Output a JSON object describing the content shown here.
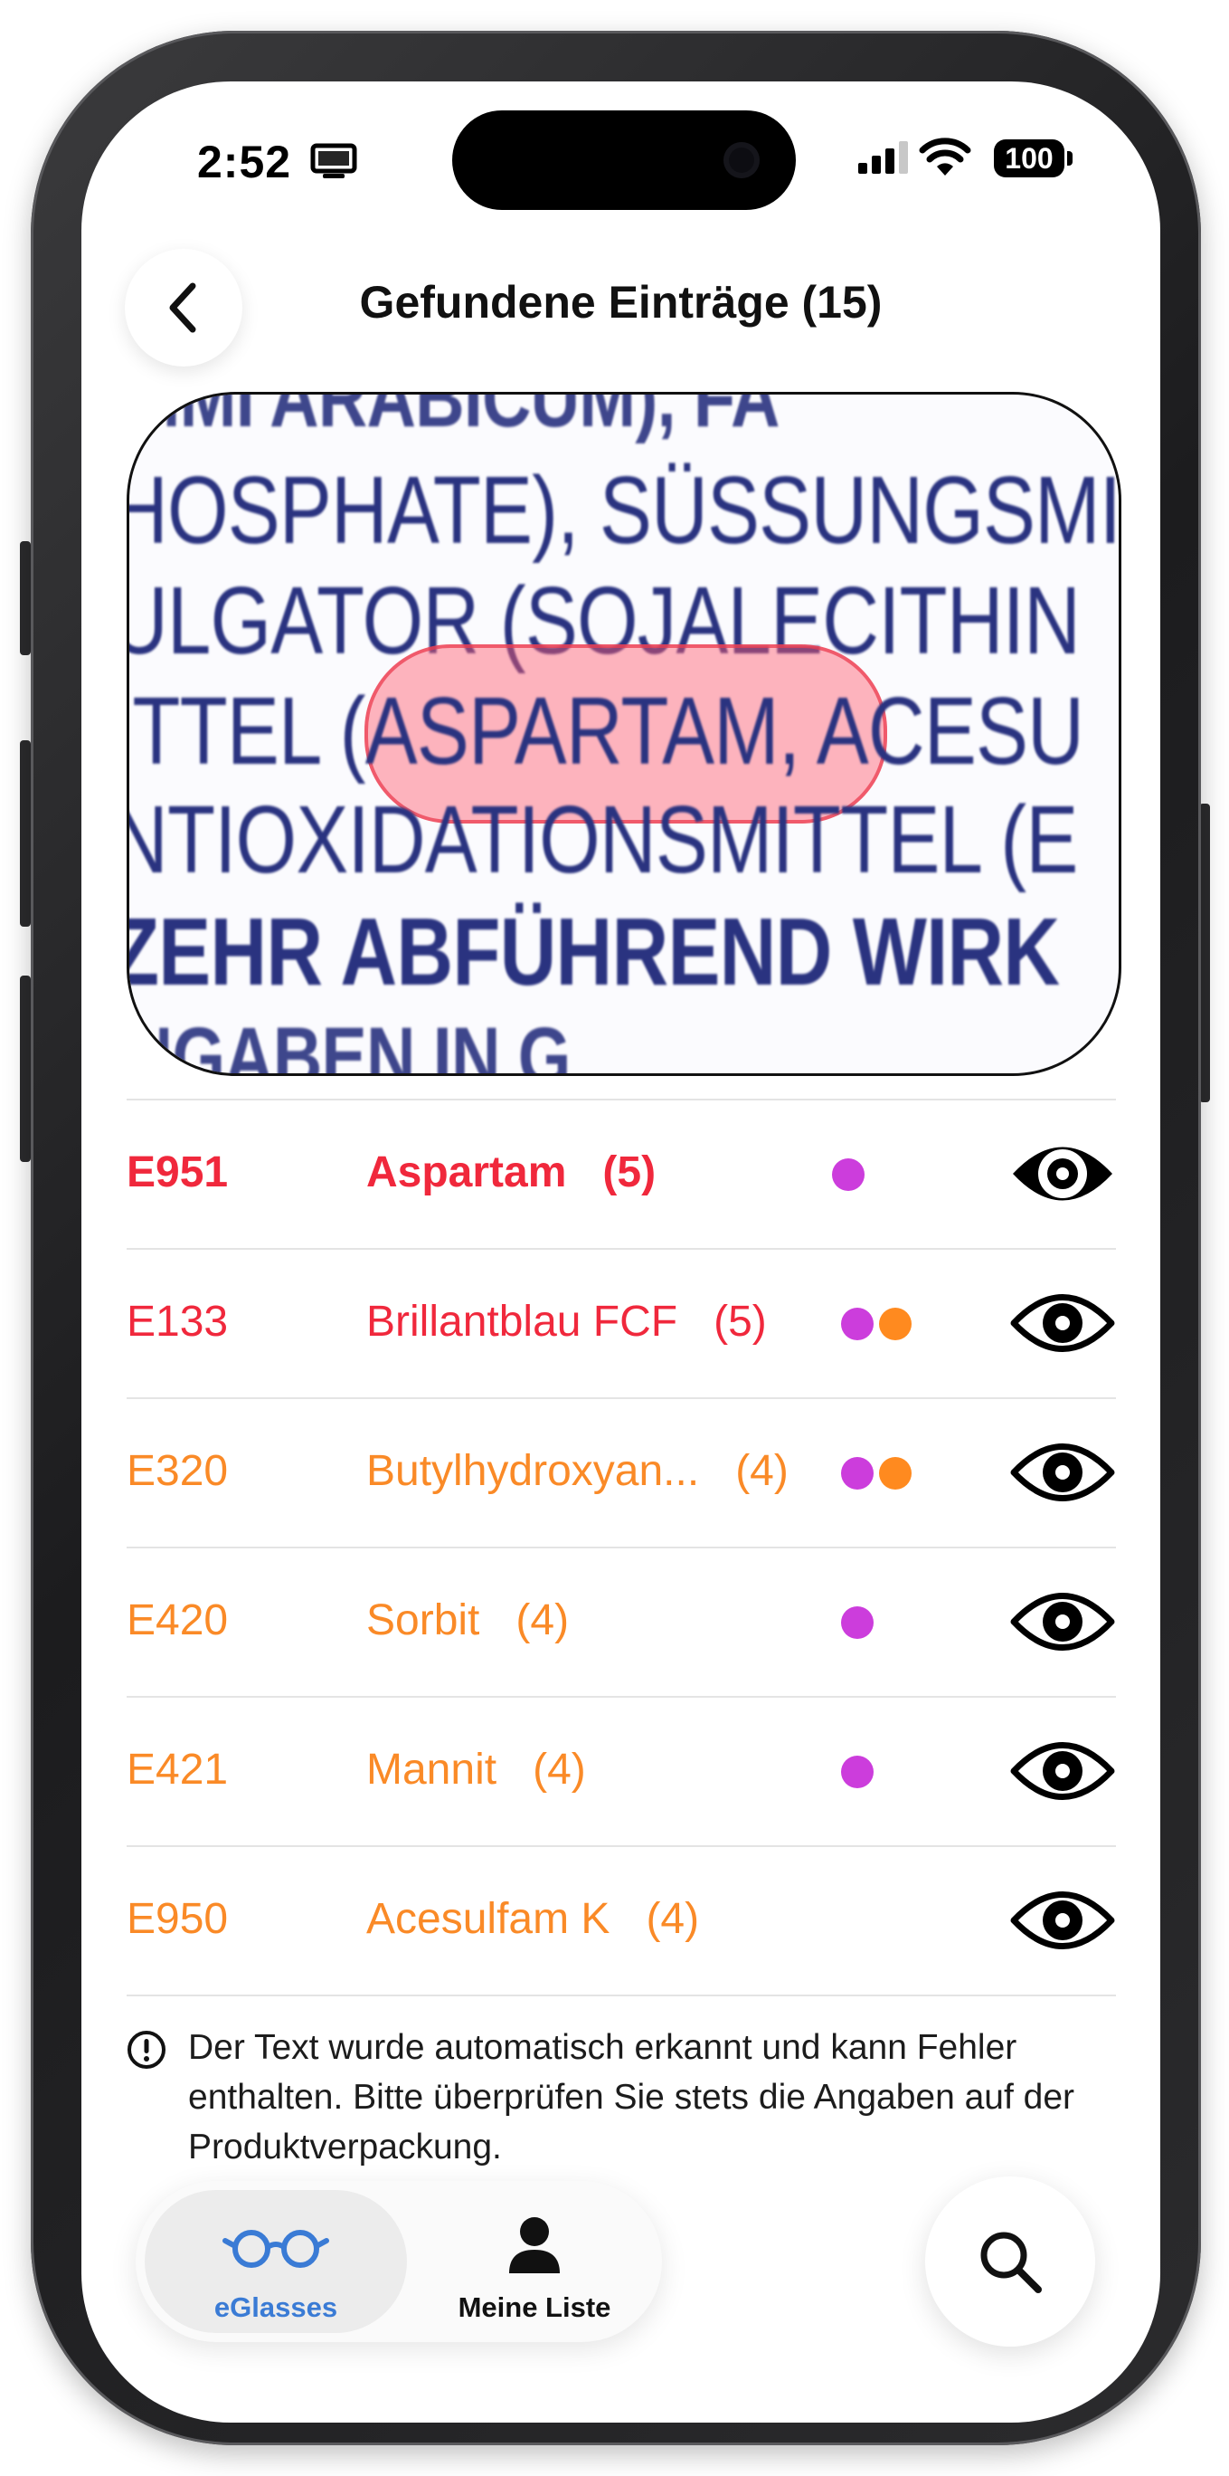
{
  "status_bar": {
    "time": "2:52",
    "battery": "100",
    "icons": [
      "monitor-icon",
      "signal-icon",
      "wifi-icon",
      "battery-icon"
    ]
  },
  "header": {
    "title": "Gefundene Einträge (15)",
    "back_icon": "chevron-left-icon"
  },
  "scan": {
    "lines": [
      "UMMI ARABICUM), FA",
      "HOSPHATE), SÜSSUNGSMI",
      "ULGATOR (SOJALECITHIN",
      "ITTEL (ASPARTAM, ACESU",
      "NTIOXIDATIONSMITTEL (E",
      "ZEHR ABFÜHREND WIRK",
      "ANGABEN IN G"
    ],
    "highlighted": "ASPARTAM"
  },
  "additives": [
    {
      "code": "E951",
      "name": "Aspartam",
      "count": "(5)",
      "color": "#f0283c",
      "bold": true,
      "dots": [
        "#cc3ddc"
      ]
    },
    {
      "code": "E133",
      "name": "Brillantblau FCF",
      "count": "(5)",
      "color": "#f0283c",
      "bold": false,
      "dots": [
        "#cc3ddc",
        "#ff8a1f"
      ]
    },
    {
      "code": "E320",
      "name": "Butylhydroxyan...",
      "count": "(4)",
      "color": "#fa8a27",
      "bold": false,
      "dots": [
        "#cc3ddc",
        "#ff8a1f"
      ]
    },
    {
      "code": "E420",
      "name": "Sorbit",
      "count": "(4)",
      "color": "#fa8a27",
      "bold": false,
      "dots": [
        "#cc3ddc"
      ]
    },
    {
      "code": "E421",
      "name": "Mannit",
      "count": "(4)",
      "color": "#fa8a27",
      "bold": false,
      "dots": [
        "#cc3ddc"
      ]
    },
    {
      "code": "E950",
      "name": "Acesulfam K",
      "count": "(4)",
      "color": "#fa8a27",
      "bold": false,
      "dots": []
    }
  ],
  "disclaimer": {
    "icon": "info-icon",
    "text": "Der Text wurde automatisch erkannt und kann Fehler enthalten. Bitte überprüfen Sie stets die Angaben auf der Produktverpackung."
  },
  "tabs": [
    {
      "label": "eGlasses",
      "icon": "glasses-icon",
      "active": true,
      "color": "#3a7bd5"
    },
    {
      "label": "Meine Liste",
      "icon": "person-icon",
      "active": false,
      "color": "#111111"
    }
  ],
  "search": {
    "icon": "search-icon"
  }
}
